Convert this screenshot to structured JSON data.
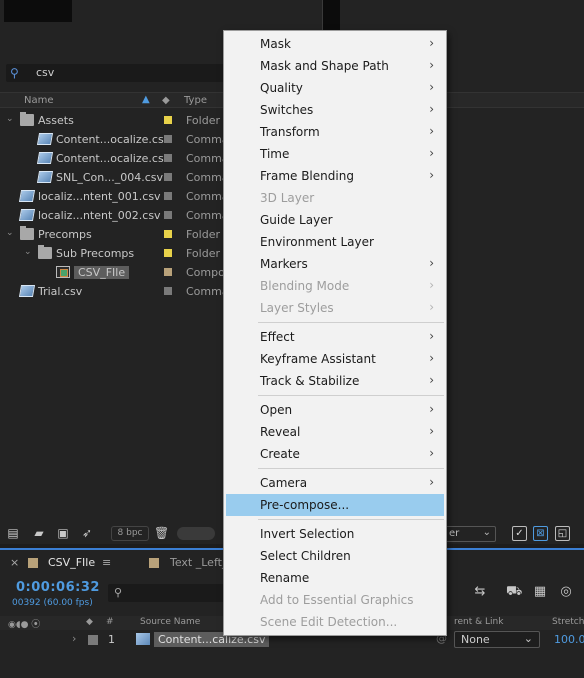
{
  "project_panel": {
    "search_value": "csv",
    "columns": {
      "name": "Name",
      "type": "Type"
    },
    "rows": [
      {
        "name": "Assets",
        "type": "Folder",
        "kind": "folder",
        "swatch": "#e8d24a",
        "indent": 0,
        "twirl": "open"
      },
      {
        "name": "Content...ocalize.csv",
        "type": "Comma",
        "kind": "csv",
        "swatch": "#7a7a7a",
        "indent": 1,
        "twirl": ""
      },
      {
        "name": "Content...ocalize.csv",
        "type": "Comma",
        "kind": "csv",
        "swatch": "#7a7a7a",
        "indent": 1,
        "twirl": ""
      },
      {
        "name": "SNL_Con..._004.csv",
        "type": "Comma",
        "kind": "csv",
        "swatch": "#7a7a7a",
        "indent": 1,
        "twirl": ""
      },
      {
        "name": "localiz...ntent_001.csv",
        "type": "Comma",
        "kind": "csv",
        "swatch": "#7a7a7a",
        "indent": 0,
        "twirl": ""
      },
      {
        "name": "localiz...ntent_002.csv",
        "type": "Comma",
        "kind": "csv",
        "swatch": "#7a7a7a",
        "indent": 0,
        "twirl": ""
      },
      {
        "name": "Precomps",
        "type": "Folder",
        "kind": "folder",
        "swatch": "#e8d24a",
        "indent": 0,
        "twirl": "open"
      },
      {
        "name": "Sub Precomps",
        "type": "Folder",
        "kind": "folder",
        "swatch": "#e8d24a",
        "indent": 1,
        "twirl": "open"
      },
      {
        "name": "CSV_FIle",
        "type": "Compos",
        "kind": "comp",
        "swatch": "#b9a27a",
        "indent": 2,
        "twirl": "",
        "selected": true
      },
      {
        "name": "Trial.csv",
        "type": "Comma",
        "kind": "csv",
        "swatch": "#7a7a7a",
        "indent": 0,
        "twirl": ""
      }
    ],
    "bpc_label": "8 bpc",
    "dropdown_tail": "er"
  },
  "timeline": {
    "active_tab": "CSV_FIle",
    "other_tab": "Text _Left_",
    "timecode": "0:00:06:32",
    "frames": "00392 (60.00 fps)",
    "headers": {
      "source_name": "Source Name",
      "parent": "rent & Link",
      "stretch": "Stretch"
    },
    "layer": {
      "index": "1",
      "name": "Content...calize.csv",
      "parent": "None",
      "stretch": "100.0"
    }
  },
  "context_menu": {
    "items": [
      {
        "label": "Mask",
        "submenu": true,
        "disabled": false
      },
      {
        "label": "Mask and Shape Path",
        "submenu": true,
        "disabled": false
      },
      {
        "label": "Quality",
        "submenu": true,
        "disabled": false
      },
      {
        "label": "Switches",
        "submenu": true,
        "disabled": false
      },
      {
        "label": "Transform",
        "submenu": true,
        "disabled": false
      },
      {
        "label": "Time",
        "submenu": true,
        "disabled": false
      },
      {
        "label": "Frame Blending",
        "submenu": true,
        "disabled": false
      },
      {
        "label": "3D Layer",
        "submenu": false,
        "disabled": true
      },
      {
        "label": "Guide Layer",
        "submenu": false,
        "disabled": false
      },
      {
        "label": "Environment Layer",
        "submenu": false,
        "disabled": false
      },
      {
        "label": "Markers",
        "submenu": true,
        "disabled": false
      },
      {
        "label": "Blending Mode",
        "submenu": true,
        "disabled": true
      },
      {
        "label": "Layer Styles",
        "submenu": true,
        "disabled": true,
        "sep_after": true
      },
      {
        "label": "Effect",
        "submenu": true,
        "disabled": false
      },
      {
        "label": "Keyframe Assistant",
        "submenu": true,
        "disabled": false
      },
      {
        "label": "Track & Stabilize",
        "submenu": true,
        "disabled": false,
        "sep_after": true
      },
      {
        "label": "Open",
        "submenu": true,
        "disabled": false
      },
      {
        "label": "Reveal",
        "submenu": true,
        "disabled": false
      },
      {
        "label": "Create",
        "submenu": true,
        "disabled": false,
        "sep_after": true
      },
      {
        "label": "Camera",
        "submenu": true,
        "disabled": false
      },
      {
        "label": "Pre-compose...",
        "submenu": false,
        "disabled": false,
        "highlighted": true,
        "sep_after": true
      },
      {
        "label": "Invert Selection",
        "submenu": false,
        "disabled": false
      },
      {
        "label": "Select Children",
        "submenu": false,
        "disabled": false
      },
      {
        "label": "Rename",
        "submenu": false,
        "disabled": false
      },
      {
        "label": "Add to Essential Graphics",
        "submenu": false,
        "disabled": true
      },
      {
        "label": "Scene Edit Detection...",
        "submenu": false,
        "disabled": true
      }
    ]
  }
}
